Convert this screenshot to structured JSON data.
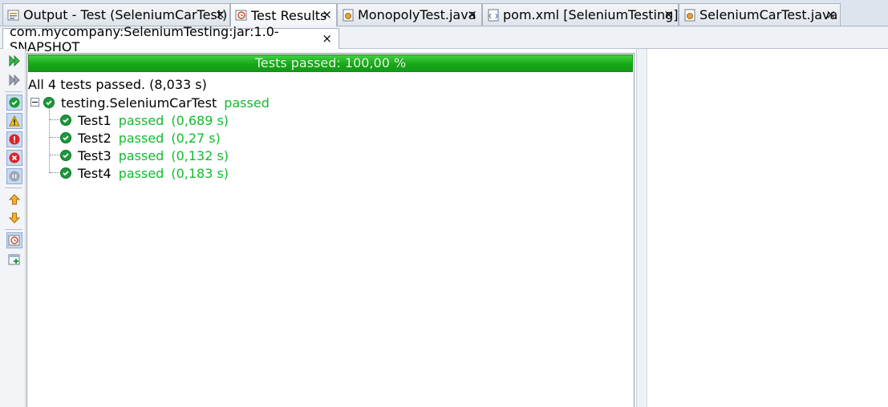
{
  "tabs": [
    {
      "label": "Output - Test (SeleniumCarTest)",
      "icon": "output-icon"
    },
    {
      "label": "Test Results",
      "icon": "test-results-icon"
    },
    {
      "label": "MonopolyTest.java",
      "icon": "java-file-icon"
    },
    {
      "label": "pom.xml [SeleniumTesting]",
      "icon": "xml-file-icon"
    },
    {
      "label": "SeleniumCarTest.java",
      "icon": "java-file-icon"
    }
  ],
  "close_glyph": "×",
  "subtab": {
    "label": "com.mycompany:SeleniumTesting:jar:1.0-SNAPSHOT"
  },
  "toolbar": [
    "rerun-icon",
    "rerun-failed-icon",
    "show-passed-icon",
    "show-passed-with-errors-icon",
    "show-failed-icon",
    "show-error-icon",
    "show-aborted-icon",
    "previous-failure-icon",
    "next-failure-icon",
    "show-timing-icon",
    "generate-test-icon"
  ],
  "progress": {
    "text": "Tests passed: 100,00 %",
    "percent": 100
  },
  "summary": "All 4 tests passed. (8,033 s)",
  "suite": {
    "name": "testing.SeleniumCarTest",
    "status": "passed"
  },
  "tests": [
    {
      "name": "Test1",
      "status": "passed",
      "time": "(0,689 s)"
    },
    {
      "name": "Test2",
      "status": "passed",
      "time": "(0,27 s)"
    },
    {
      "name": "Test3",
      "status": "passed",
      "time": "(0,132 s)"
    },
    {
      "name": "Test4",
      "status": "passed",
      "time": "(0,183 s)"
    }
  ],
  "colors": {
    "pass_green": "#11bb2f",
    "progress_green": "#18a818",
    "icon_green": "#1a9a3a"
  }
}
